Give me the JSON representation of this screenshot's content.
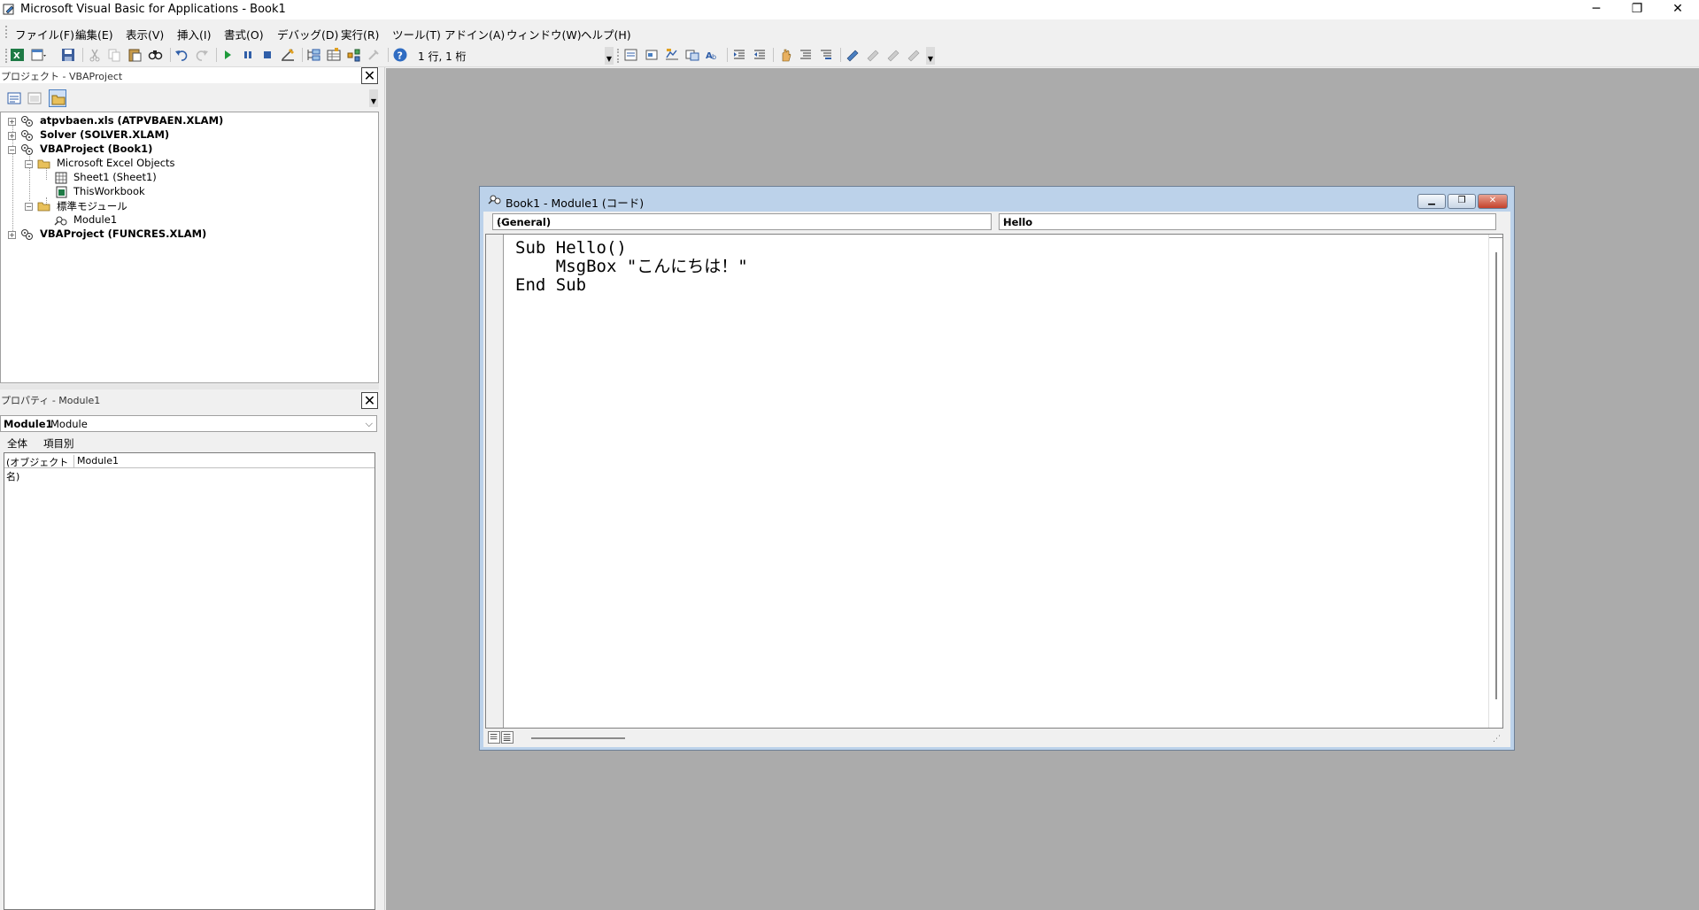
{
  "window": {
    "title": "Microsoft Visual Basic for Applications - Book1",
    "minimize": "─",
    "restore": "❐",
    "close": "✕"
  },
  "menu": [
    "ファイル(F)",
    "編集(E)",
    "表示(V)",
    "挿入(I)",
    "書式(O)",
    "デバッグ(D)",
    "実行(R)",
    "ツール(T)",
    "アドイン(A)",
    "ウィンドウ(W)",
    "ヘルプ(H)"
  ],
  "toolbar": {
    "status": "1 行, 1 桁"
  },
  "project_panel": {
    "title": "プロジェクト - VBAProject",
    "close": "✕",
    "tree": [
      {
        "label": "atpvbaen.xls (ATPVBAEN.XLAM)",
        "bold": true
      },
      {
        "label": "Solver (SOLVER.XLAM)",
        "bold": true
      },
      {
        "label": "VBAProject (Book1)",
        "bold": true
      },
      {
        "label": "Microsoft Excel Objects",
        "bold": false
      },
      {
        "label": "Sheet1 (Sheet1)",
        "bold": false
      },
      {
        "label": "ThisWorkbook",
        "bold": false
      },
      {
        "label": "標準モジュール",
        "bold": false
      },
      {
        "label": "Module1",
        "bold": false
      },
      {
        "label": "VBAProject (FUNCRES.XLAM)",
        "bold": true
      }
    ]
  },
  "properties_panel": {
    "title": "プロパティ - Module1",
    "close": "✕",
    "object_name": "Module1",
    "object_type": "Module",
    "tabs": [
      "全体",
      "項目別"
    ],
    "rows": [
      {
        "key": "(オブジェクト名)",
        "value": "Module1"
      }
    ]
  },
  "code_window": {
    "title": "Book1 - Module1 (コード)",
    "object_combo": "(General)",
    "procedure_combo": "Hello",
    "code": [
      "Sub Hello()",
      "    MsgBox \"こんにちは！\"",
      "End Sub"
    ],
    "minimize": "▁",
    "restore": "❐",
    "close": "✕"
  }
}
